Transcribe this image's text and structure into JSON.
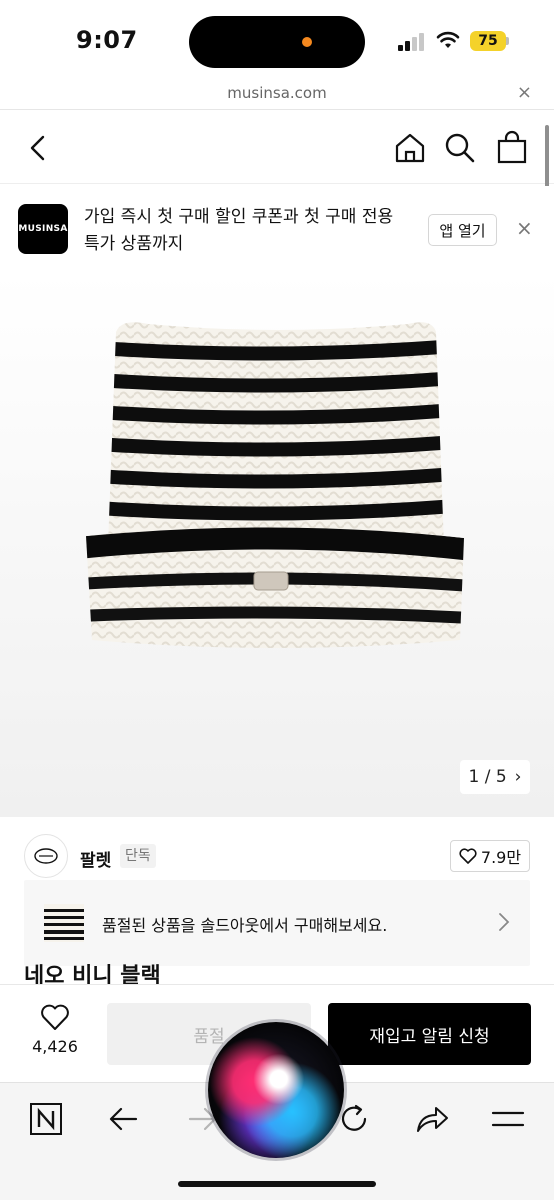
{
  "status_bar": {
    "time": "9:07",
    "battery": "75"
  },
  "browser": {
    "url": "musinsa.com",
    "close_label": "×"
  },
  "header": {
    "icons": [
      "back-icon",
      "home-icon",
      "search-icon",
      "shopping-bag-icon"
    ]
  },
  "app_banner": {
    "logo": "MUSINSA",
    "text": "가입 즉시 첫 구매 할인 쿠폰과 첫 구매 전용 특가 상품까지",
    "open_button": "앱 열기",
    "close_label": "×"
  },
  "product_image": {
    "counter": "1 / 5",
    "counter_chevron": "›",
    "current": 1,
    "total": 5
  },
  "brand": {
    "name": "팔렛",
    "tag": "단독",
    "likes": "7.9만"
  },
  "notice": {
    "text": "품절된 상품을 솔드아웃에서 구매해보세요."
  },
  "product": {
    "title": "네오 비니 블랙"
  },
  "purchase_bar": {
    "wish_count": "4,426",
    "soldout_label": "품절",
    "restock_label": "재입고 알림 신청"
  },
  "colors": {
    "primary": "#000000",
    "disabled_bg": "#f0f0f0",
    "battery": "#f4d22a",
    "indicator": "#f5891f"
  }
}
